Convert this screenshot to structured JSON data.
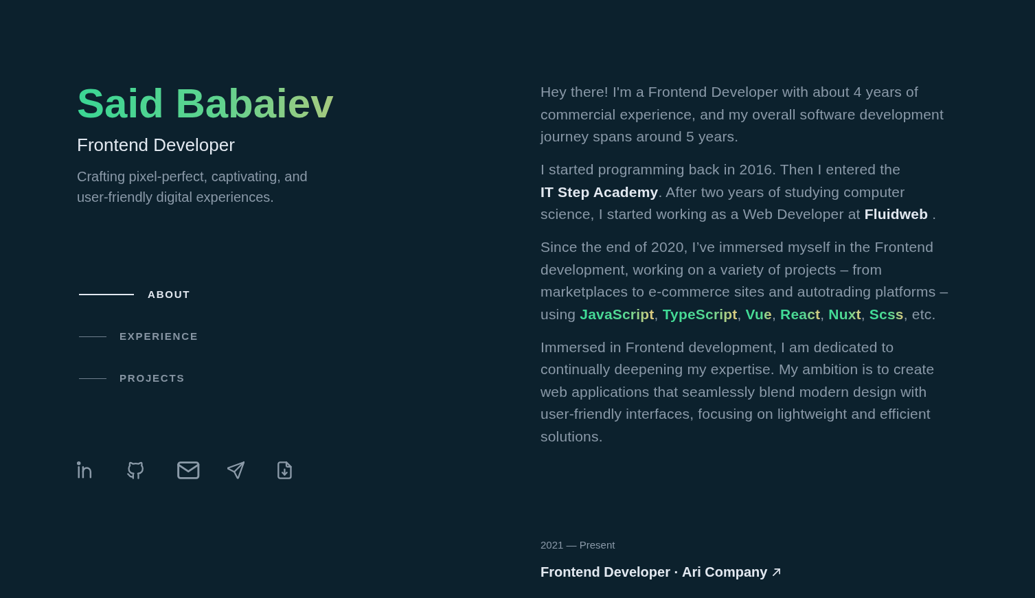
{
  "profile": {
    "name": "Said Babaiev",
    "role": "Frontend Developer",
    "tagline": "Crafting pixel-perfect, captivating, and user-friendly digital experiences."
  },
  "nav": [
    {
      "label": "ABOUT",
      "selected": true
    },
    {
      "label": "EXPERIENCE",
      "selected": false
    },
    {
      "label": "PROJECTS",
      "selected": false
    }
  ],
  "socials": [
    {
      "kind": "linkedin"
    },
    {
      "kind": "github"
    },
    {
      "kind": "mail"
    },
    {
      "kind": "plane"
    },
    {
      "kind": "file-download"
    }
  ],
  "about": {
    "paragraphs": [
      [
        {
          "kind": "plain",
          "text": "Hey there! I'm a Frontend Developer with about 4 years of commercial experience, and my overall software development journey spans around 5 years."
        }
      ],
      [
        {
          "kind": "plain",
          "text": "I started programming back in 2016. Then I entered the "
        },
        {
          "kind": "link",
          "text": "IT Step Academy"
        },
        {
          "kind": "plain",
          "text": ". After two years of studying computer science, I started working as a Web Developer at "
        },
        {
          "kind": "link",
          "text": "Fluidweb"
        },
        {
          "kind": "plain",
          "text": " ."
        }
      ],
      [
        {
          "kind": "plain",
          "text": "Since the end of 2020, I’ve immersed myself in the Frontend development, working on a variety of projects – from marketplaces to e-commerce sites and autotrading platforms – using "
        },
        {
          "kind": "highlight",
          "text": "JavaScript"
        },
        {
          "kind": "plain",
          "text": ", "
        },
        {
          "kind": "highlight",
          "text": "TypeScript"
        },
        {
          "kind": "plain",
          "text": ", "
        },
        {
          "kind": "highlight",
          "text": "Vue"
        },
        {
          "kind": "plain",
          "text": ", "
        },
        {
          "kind": "highlight",
          "text": "React"
        },
        {
          "kind": "plain",
          "text": ", "
        },
        {
          "kind": "highlight",
          "text": "Nuxt"
        },
        {
          "kind": "plain",
          "text": ", "
        },
        {
          "kind": "highlight",
          "text": "Scss"
        },
        {
          "kind": "plain",
          "text": ", etc."
        }
      ],
      [
        {
          "kind": "plain",
          "text": "Immersed in Frontend development, I am dedicated to continually deepening my expertise. My ambition is to create web applications that seamlessly blend modern design with user-friendly interfaces, focusing on lightweight and efficient solutions."
        }
      ]
    ]
  },
  "experience": [
    {
      "period": "2021 — Present",
      "title": "Frontend Developer · Ari Company"
    }
  ]
}
